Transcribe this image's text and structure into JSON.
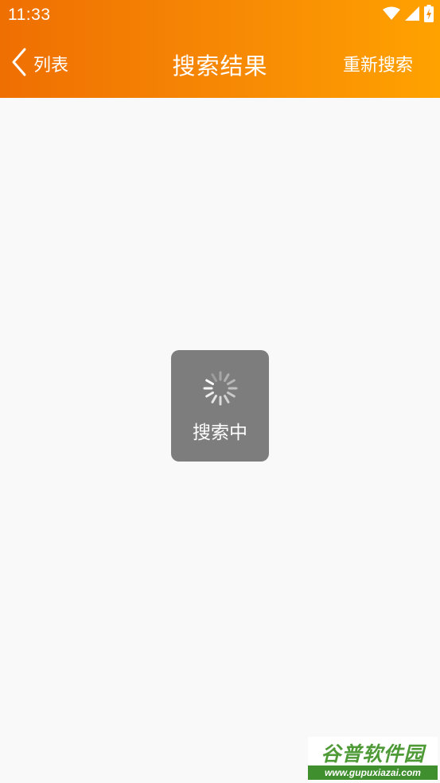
{
  "status_bar": {
    "time": "11:33",
    "icons": [
      "wifi-icon",
      "signal-icon",
      "battery-charging-icon"
    ]
  },
  "nav": {
    "back_label": "列表",
    "title": "搜索结果",
    "action_label": "重新搜索"
  },
  "loading": {
    "text": "搜索中",
    "icon": "spinner-icon"
  },
  "watermark": {
    "title": "谷普软件园",
    "url": "www.gupuxiazai.com"
  },
  "colors": {
    "header_gradient_start": "#ef6f02",
    "header_gradient_end": "#ffa200",
    "background": "#f9f9f9",
    "toast_background": "#7d7d7d"
  }
}
